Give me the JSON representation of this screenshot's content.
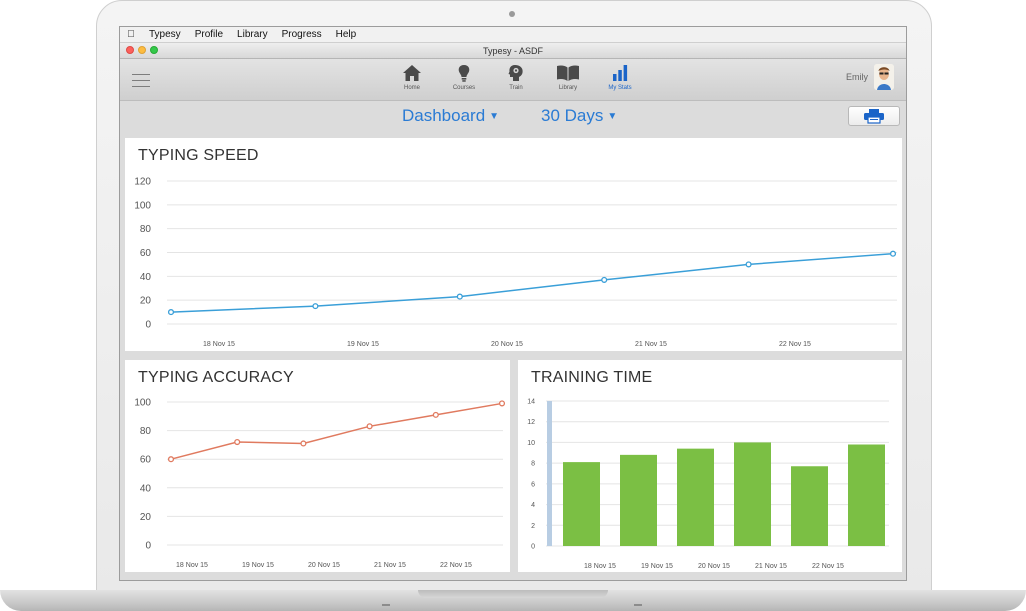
{
  "menubar": {
    "apple_icon": "apple-logo-icon",
    "items": [
      "Typesy",
      "Profile",
      "Library",
      "Progress",
      "Help"
    ]
  },
  "window": {
    "title": "Typesy - ASDF"
  },
  "toolbar": {
    "nav": [
      {
        "label": "Home",
        "icon": "home-icon",
        "active": false
      },
      {
        "label": "Courses",
        "icon": "lightbulb-icon",
        "active": false
      },
      {
        "label": "Train",
        "icon": "brain-head-icon",
        "active": false
      },
      {
        "label": "Library",
        "icon": "book-icon",
        "active": false
      },
      {
        "label": "My Stats",
        "icon": "bar-chart-icon",
        "active": true
      }
    ],
    "user_name": "Emily"
  },
  "subbar": {
    "view_select": "Dashboard",
    "range_select": "30 Days",
    "print_icon": "printer-icon"
  },
  "colors": {
    "accent": "#2a7bd4",
    "speed_line": "#3a9fd8",
    "accuracy_line": "#e07a5f",
    "training_bar": "#7bbf44"
  },
  "chart_data": [
    {
      "type": "line",
      "title": "TYPING SPEED",
      "x": [
        "18 Nov 15",
        "19 Nov 15",
        "20 Nov 15",
        "21 Nov 15",
        "22 Nov 15"
      ],
      "y_ticks": [
        0,
        20,
        40,
        60,
        80,
        100,
        120
      ],
      "ylim": [
        0,
        120
      ],
      "series": [
        {
          "values": [
            10,
            15,
            23,
            37,
            50,
            59
          ]
        }
      ],
      "grid": true
    },
    {
      "type": "line",
      "title": "TYPING ACCURACY",
      "x": [
        "18 Nov 15",
        "19 Nov 15",
        "20 Nov 15",
        "21 Nov 15",
        "22 Nov 15"
      ],
      "y_ticks": [
        0,
        20,
        40,
        60,
        80,
        100
      ],
      "ylim": [
        0,
        100
      ],
      "series": [
        {
          "values": [
            60,
            72,
            71,
            83,
            91,
            99
          ]
        }
      ],
      "grid": true
    },
    {
      "type": "bar",
      "title": "TRAINING TIME",
      "categories": [
        "18 Nov 15",
        "19 Nov 15",
        "20 Nov 15",
        "21 Nov 15",
        "22 Nov 15"
      ],
      "y_ticks": [
        0,
        2,
        4,
        6,
        8,
        10,
        12,
        14
      ],
      "ylim": [
        0,
        14
      ],
      "values": [
        8.1,
        8.8,
        9.4,
        10.0,
        7.7,
        9.8
      ],
      "grid": true
    }
  ]
}
